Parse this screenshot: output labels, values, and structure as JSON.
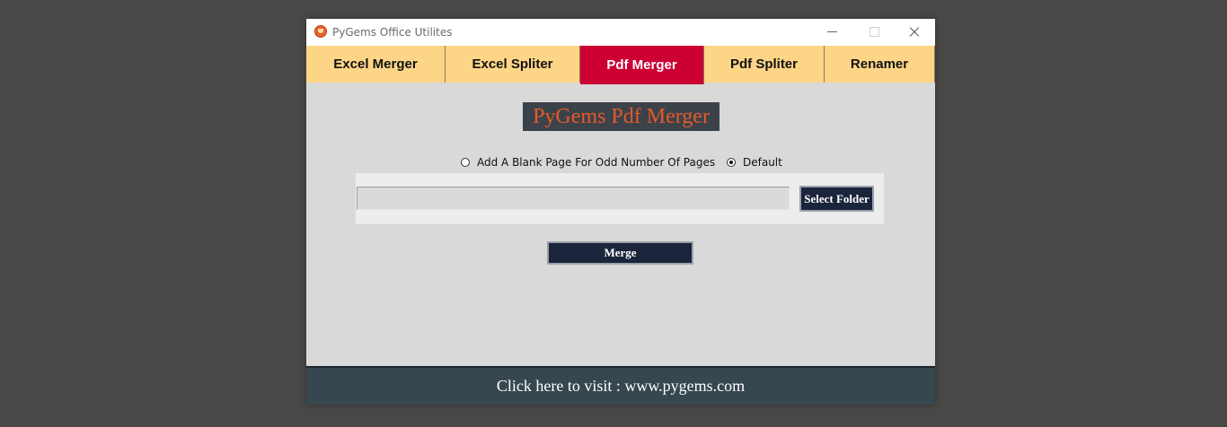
{
  "window": {
    "title": "PyGems Office Utilites",
    "icon": "pygems-app-icon"
  },
  "tabs": [
    {
      "label": "Excel Merger",
      "active": false
    },
    {
      "label": "Excel Spliter",
      "active": false
    },
    {
      "label": "Pdf Merger",
      "active": true
    },
    {
      "label": "Pdf Spliter",
      "active": false
    },
    {
      "label": "Renamer",
      "active": false
    }
  ],
  "main": {
    "heading": "PyGems Pdf Merger",
    "options": [
      {
        "label": "Add A Blank Page For Odd Number Of Pages",
        "selected": false
      },
      {
        "label": "Default",
        "selected": true
      }
    ],
    "folder_path": "",
    "select_folder_label": "Select Folder",
    "merge_label": "Merge"
  },
  "footer": {
    "link_text": "Click here to visit : www.pygems.com"
  },
  "colors": {
    "tab_bg": "#fdd587",
    "tab_active_bg": "#cc0033",
    "heading_text": "#e45a2a",
    "heading_bg": "#3c4249",
    "button_bg": "#1a243b",
    "footer_bg": "#37474f"
  }
}
